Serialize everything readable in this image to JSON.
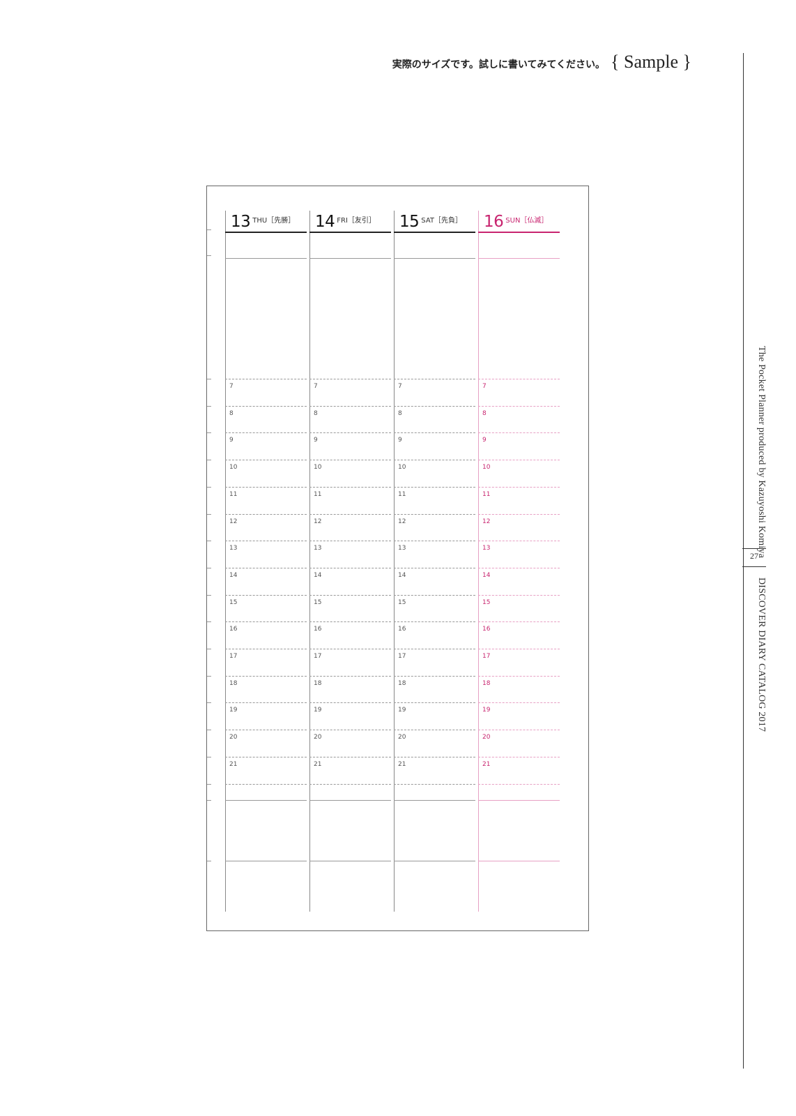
{
  "header": {
    "jp_text": "実際のサイズです。試しに書いてみてください。",
    "sample_label": "{ Sample }"
  },
  "sidebar": {
    "title": "The Pocket Planner produced by Kazuyoshi Komiya",
    "page_number": "27",
    "catalog": "DISCOVER DIARY CATALOG 2017"
  },
  "planner": {
    "days": [
      {
        "date": "13",
        "label": "THU［先勝］"
      },
      {
        "date": "14",
        "label": "FRI［友引］"
      },
      {
        "date": "15",
        "label": "SAT［先負］"
      },
      {
        "date": "16",
        "label": "SUN［仏滅］"
      }
    ],
    "hours": [
      "7",
      "8",
      "9",
      "10",
      "11",
      "12",
      "13",
      "14",
      "15",
      "16",
      "17",
      "18",
      "19",
      "20",
      "21"
    ]
  },
  "colors": {
    "ink": "#222222",
    "sunday_accent": "#c8246f",
    "rule_gray": "#999999"
  }
}
